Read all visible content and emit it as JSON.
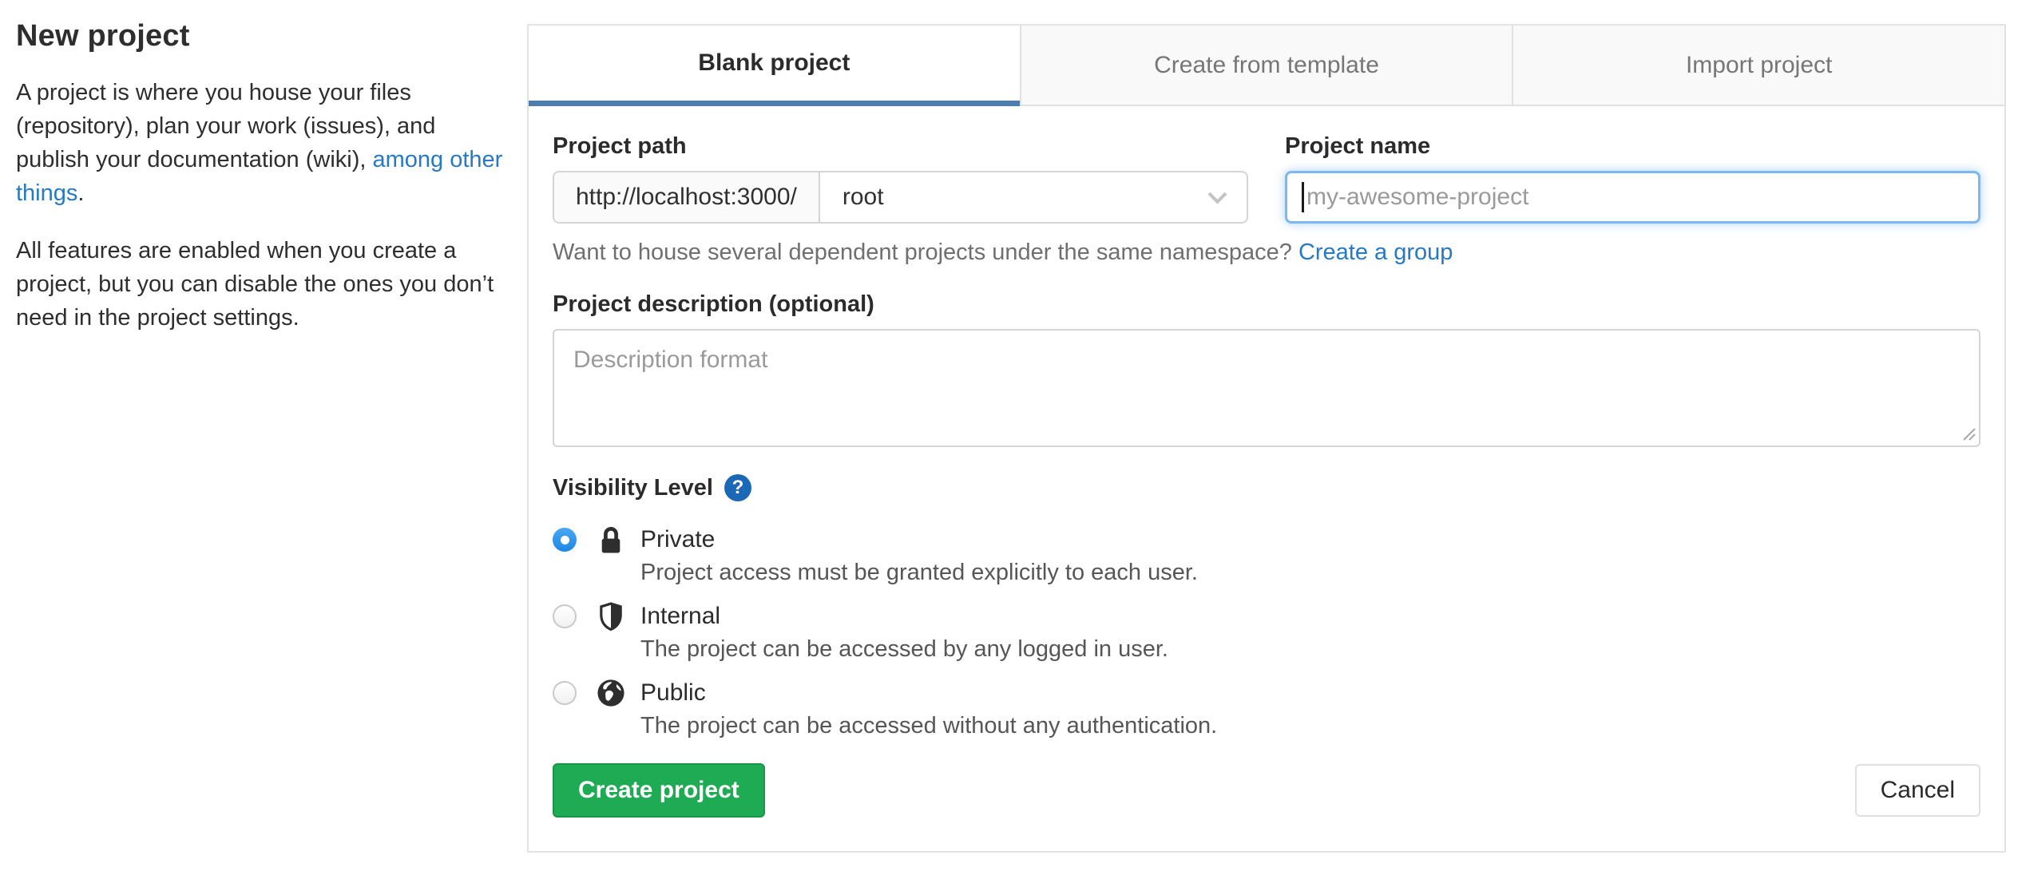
{
  "intro": {
    "title": "New project",
    "para1_pre": "A project is where you house your files (repository), plan your work (issues), and publish your documentation (wiki), ",
    "para1_link": "among other things",
    "para1_post": ".",
    "para2": "All features are enabled when you create a project, but you can disable the ones you don’t need in the project settings."
  },
  "tabs": [
    {
      "label": "Blank project",
      "active": true
    },
    {
      "label": "Create from template",
      "active": false
    },
    {
      "label": "Import project",
      "active": false
    }
  ],
  "form": {
    "project_path": {
      "label": "Project path",
      "url_prefix": "http://localhost:3000/",
      "namespace_selected": "root"
    },
    "project_name": {
      "label": "Project name",
      "placeholder": "my-awesome-project",
      "value": ""
    },
    "namespace_hint": {
      "text": "Want to house several dependent projects under the same namespace? ",
      "link": "Create a group"
    },
    "description": {
      "label": "Project description (optional)",
      "placeholder": "Description format",
      "value": ""
    },
    "visibility": {
      "label": "Visibility Level",
      "help_glyph": "?",
      "options": [
        {
          "name": "Private",
          "description": "Project access must be granted explicitly to each user.",
          "icon": "lock-icon",
          "selected": true
        },
        {
          "name": "Internal",
          "description": "The project can be accessed by any logged in user.",
          "icon": "shield-icon",
          "selected": false
        },
        {
          "name": "Public",
          "description": "The project can be accessed without any authentication.",
          "icon": "globe-icon",
          "selected": false
        }
      ]
    },
    "submit_label": "Create project",
    "cancel_label": "Cancel"
  },
  "colors": {
    "link": "#2779c4",
    "active_tab_underline": "#4d7cae",
    "focus_ring": "#7db7ef",
    "create_button": "#1fab53",
    "radio_selected": "#2f9ceb",
    "help_badge": "#1b69b6"
  }
}
